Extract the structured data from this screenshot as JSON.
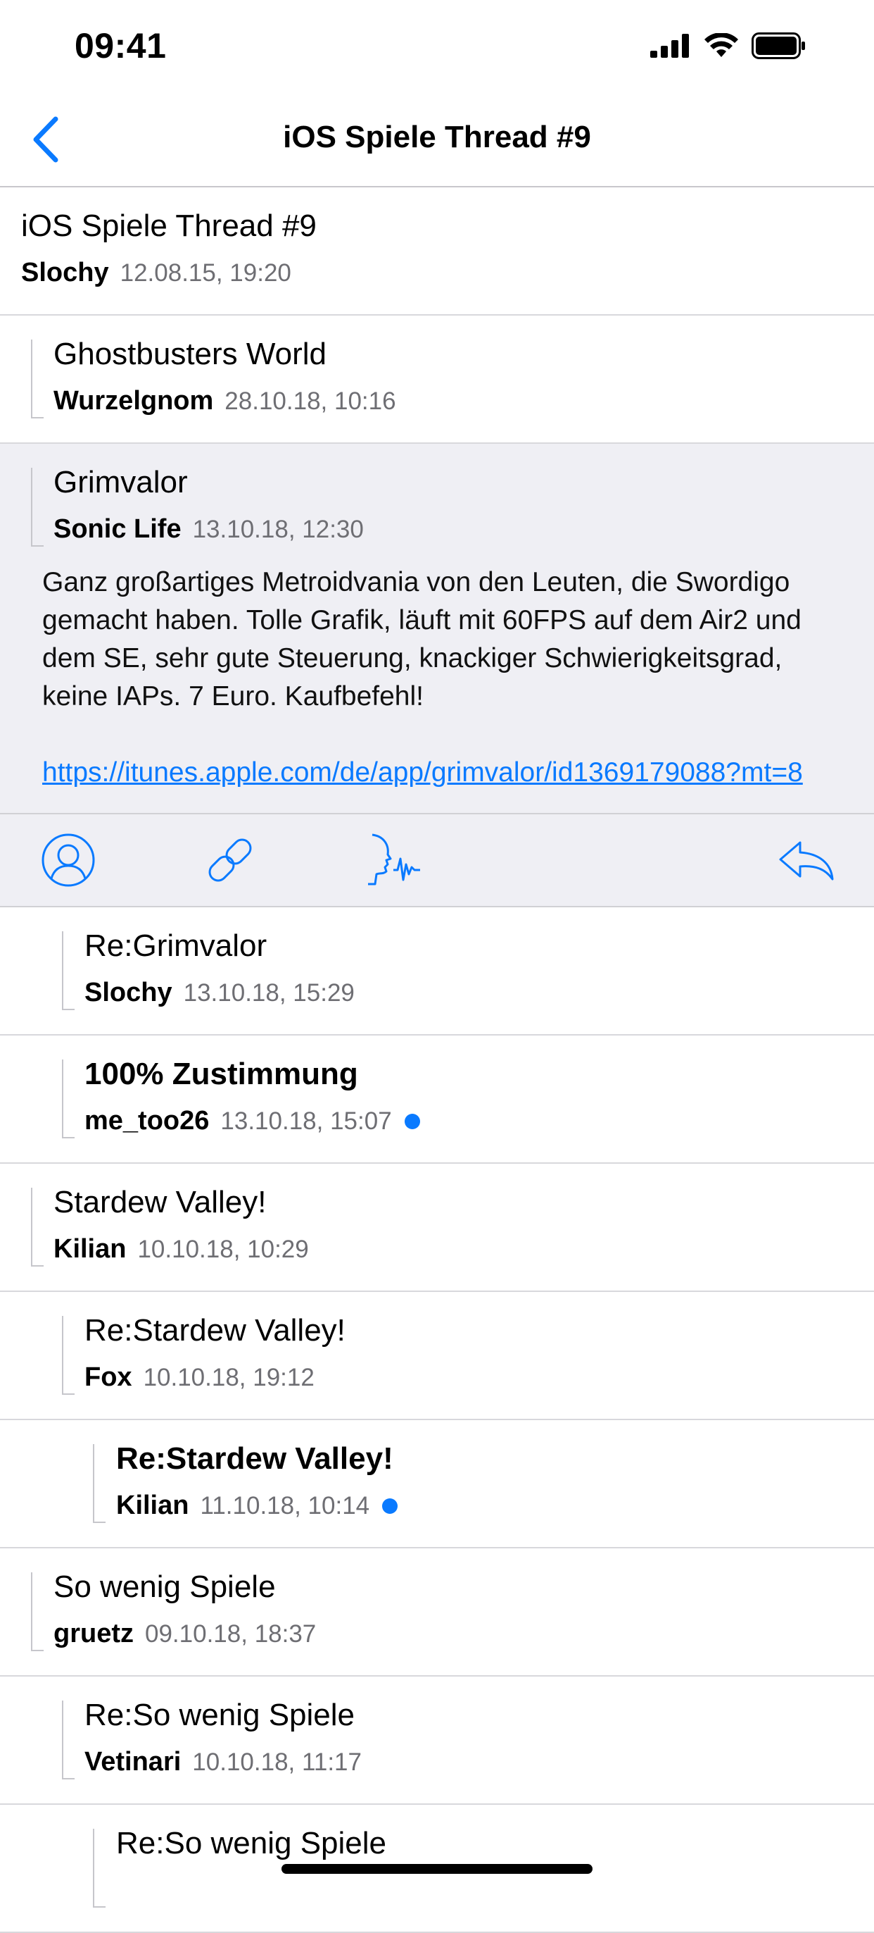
{
  "status_bar": {
    "time": "09:41"
  },
  "nav": {
    "title": "iOS Spiele Thread #9"
  },
  "thread": [
    {
      "title": "iOS Spiele Thread #9",
      "author": "Slochy",
      "date": "12.08.15, 19:20",
      "level": 0,
      "unread": false
    },
    {
      "title": "Ghostbusters World",
      "author": "Wurzelgnom",
      "date": "28.10.18, 10:16",
      "level": 1,
      "unread": false
    }
  ],
  "expanded_post": {
    "title": "Grimvalor",
    "author": "Sonic Life",
    "date": "13.10.18, 12:30",
    "body": "Ganz großartiges Metroidvania von den Leuten, die Swordigo gemacht haben. Tolle Grafik, läuft mit 60FPS auf dem Air2 und dem SE, sehr gute Steuerung, knackiger Schwierigkeitsgrad, keine IAPs. 7 Euro. Kaufbefehl!",
    "link": "https://itunes.apple.com/de/app/grimvalor/id1369179088?mt=8",
    "actions": [
      "profile-icon",
      "link-icon",
      "speak-icon",
      "reply-icon"
    ]
  },
  "replies": [
    {
      "title": "Re:Grimvalor",
      "author": "Slochy",
      "date": "13.10.18, 15:29",
      "level": 2,
      "unread": false
    },
    {
      "title": "100% Zustimmung",
      "author": "me_too26",
      "date": "13.10.18, 15:07",
      "level": 2,
      "unread": true
    },
    {
      "title": "Stardew Valley!",
      "author": "Kilian",
      "date": "10.10.18, 10:29",
      "level": 1,
      "unread": false
    },
    {
      "title": "Re:Stardew Valley!",
      "author": "Fox",
      "date": "10.10.18, 19:12",
      "level": 2,
      "unread": false
    },
    {
      "title": "Re:Stardew Valley!",
      "author": "Kilian",
      "date": "11.10.18, 10:14",
      "level": 3,
      "unread": true
    },
    {
      "title": "So wenig Spiele",
      "author": "gruetz",
      "date": "09.10.18, 18:37",
      "level": 1,
      "unread": false
    },
    {
      "title": "Re:So wenig Spiele",
      "author": "Vetinari",
      "date": "10.10.18, 11:17",
      "level": 2,
      "unread": false
    },
    {
      "title": "Re:So wenig Spiele",
      "author": "",
      "date": "",
      "level": 3,
      "unread": false
    }
  ],
  "colors": {
    "accent": "#0a7aff",
    "expanded_bg": "#efeff4",
    "separator": "#d8d8dc"
  }
}
